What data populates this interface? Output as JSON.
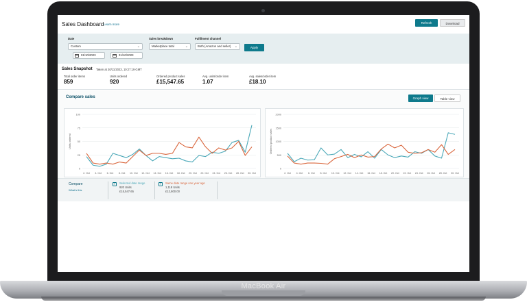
{
  "device": {
    "brand": "MacBook Air"
  },
  "header": {
    "title": "Sales Dashboard",
    "learn_more": "Learn more",
    "refresh_label": "Refresh",
    "download_label": "Download"
  },
  "filters": {
    "date_label": "Date",
    "date_value": "Custom",
    "start_date": "01/10/2023",
    "end_date": "31/10/2023",
    "breakdown_label": "Sales breakdown",
    "breakdown_value": "Marketplace total",
    "channel_label": "Fulfilment channel",
    "channel_value": "Both (Amazon and seller)",
    "apply_label": "Apply"
  },
  "snapshot": {
    "title": "Sales Snapshot",
    "taken_at": "Taken at 20/11/2023, 10:27:19 GMT",
    "metrics": [
      {
        "label": "Total order items",
        "value": "859"
      },
      {
        "label": "Units ordered",
        "value": "920"
      },
      {
        "label": "Ordered product sales",
        "value": "£15,547.65"
      },
      {
        "label": "Avg. units/order item",
        "value": "1.07"
      },
      {
        "label": "Avg. sales/order item",
        "value": "£18.10"
      }
    ]
  },
  "compare": {
    "title": "Compare sales",
    "graph_view": "Graph view",
    "table_view": "Table view",
    "legend_title": "Compare",
    "whats_this": "What's this",
    "selected": {
      "label": "Selected date range",
      "units": "920 Units",
      "sales": "£15,547.65"
    },
    "last_year": {
      "label": "Same date range one year ago",
      "units": "1,118 Units",
      "sales": "£12,800.00"
    }
  },
  "colors": {
    "selected": "#4aa8b8",
    "last_year": "#d9653b",
    "accent": "#0e7a8c"
  },
  "chart_data": [
    {
      "type": "line",
      "ylabel": "Units ordered",
      "ylim": [
        0,
        100
      ],
      "yticks": [
        "0",
        "25",
        "50",
        "75",
        "100"
      ],
      "categories": [
        "2. Oct",
        "4. Oct",
        "6. Oct",
        "8. Oct",
        "10. Oct",
        "12. Oct",
        "14. Oct",
        "16. Oct",
        "18. Oct",
        "20. Oct",
        "22. Oct",
        "24. Oct",
        "26. Oct",
        "28. Oct",
        "30. Oct"
      ],
      "series": [
        {
          "name": "Selected date range",
          "values": [
            22,
            6,
            4,
            8,
            28,
            24,
            20,
            26,
            36,
            24,
            14,
            22,
            20,
            18,
            19,
            14,
            12,
            24,
            22,
            30,
            28,
            32,
            48,
            52,
            30,
            80
          ]
        },
        {
          "name": "Same date range one year ago",
          "values": [
            28,
            10,
            8,
            10,
            8,
            12,
            10,
            22,
            34,
            24,
            28,
            28,
            26,
            28,
            48,
            40,
            38,
            58,
            40,
            28,
            38,
            34,
            38,
            50,
            24,
            40
          ]
        }
      ]
    },
    {
      "type": "line",
      "ylabel": "Ordered product sales",
      "ylim": [
        0,
        2000
      ],
      "yticks": [
        "0",
        "500",
        "1000",
        "1500",
        "2000"
      ],
      "categories": [
        "2. Oct",
        "4. Oct",
        "6. Oct",
        "8. Oct",
        "10. Oct",
        "12. Oct",
        "14. Oct",
        "16. Oct",
        "18. Oct",
        "20. Oct",
        "22. Oct",
        "24. Oct",
        "26. Oct",
        "28. Oct",
        "30. Oct"
      ],
      "series": [
        {
          "name": "Selected date range",
          "values": [
            560,
            250,
            380,
            310,
            320,
            760,
            500,
            530,
            700,
            400,
            520,
            430,
            620,
            380,
            700,
            500,
            400,
            460,
            420,
            620,
            560,
            700,
            460,
            380,
            1320,
            1260
          ]
        },
        {
          "name": "Same date range one year ago",
          "values": [
            460,
            200,
            160,
            200,
            200,
            190,
            160,
            360,
            440,
            520,
            400,
            500,
            420,
            440,
            720,
            900,
            760,
            860,
            600,
            560,
            580,
            700,
            600,
            880,
            520,
            700
          ]
        }
      ]
    }
  ]
}
